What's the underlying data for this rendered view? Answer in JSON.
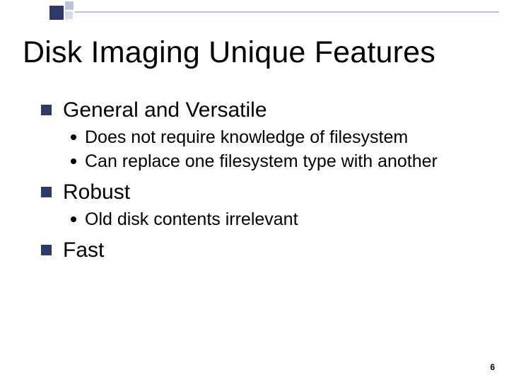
{
  "slide": {
    "title": "Disk Imaging Unique Features",
    "bullets": [
      {
        "text": "General and Versatile",
        "sub": [
          "Does not require knowledge of filesystem",
          "Can replace one filesystem type with another"
        ]
      },
      {
        "text": "Robust",
        "sub": [
          "Old disk contents irrelevant"
        ]
      },
      {
        "text": "Fast",
        "sub": []
      }
    ],
    "page_number": "6"
  }
}
